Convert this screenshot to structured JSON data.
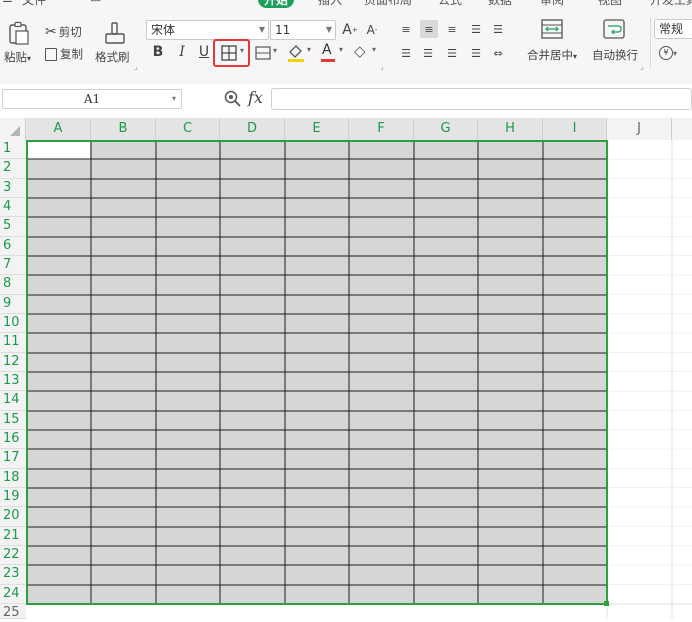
{
  "menu": {
    "file": "文件",
    "active_tab": "开始",
    "tabs": [
      "插入",
      "页面布局",
      "公式",
      "数据",
      "审阅",
      "视图",
      "开发工具"
    ]
  },
  "ribbon": {
    "paste": "粘贴",
    "cut": "剪切",
    "copy": "复制",
    "format_painter": "格式刷",
    "font_name": "宋体",
    "font_size": "11",
    "bold": "B",
    "italic": "I",
    "underline": "U",
    "font_color": "A",
    "merge_center": "合并居中",
    "wrap_text": "自动换行",
    "number_format": "常规"
  },
  "formula_bar": {
    "cell_ref": "A1",
    "fx": "fx",
    "value": ""
  },
  "sheet": {
    "columns": [
      "A",
      "B",
      "C",
      "D",
      "E",
      "F",
      "G",
      "H",
      "I",
      "J"
    ],
    "rows": [
      "1",
      "2",
      "3",
      "4",
      "5",
      "6",
      "7",
      "8",
      "9",
      "10",
      "11",
      "12",
      "13",
      "14",
      "15",
      "16",
      "17",
      "18",
      "19",
      "20",
      "21",
      "22",
      "23",
      "24",
      "25"
    ],
    "selection": "A1:I24",
    "colors": {
      "selection_fill": "#d6d6d6",
      "selection_border": "#2e9e3e",
      "header_text": "#1a9a4a",
      "active_tab": "#1aa05a",
      "highlight": "#e53935"
    }
  }
}
